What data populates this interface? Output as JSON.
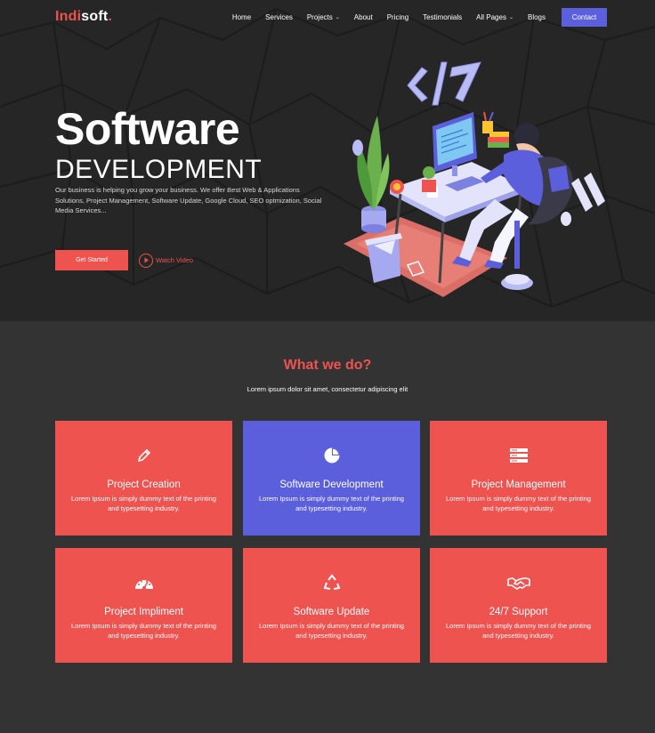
{
  "brand": {
    "part1": "Indi",
    "part2": "soft",
    "dot": "."
  },
  "nav": {
    "items": [
      {
        "label": "Home"
      },
      {
        "label": "Services"
      },
      {
        "label": "Projects",
        "chevron": "⌄"
      },
      {
        "label": "About"
      },
      {
        "label": "Pricing"
      },
      {
        "label": "Testimonials"
      },
      {
        "label": "All Pages",
        "chevron": "⌄"
      },
      {
        "label": "Blogs"
      }
    ],
    "contact_label": "Contact"
  },
  "hero": {
    "title": "Software",
    "subtitle": "DEVELOPMENT",
    "description": "Our business is helping you grow your business. We offer Best Web & Applications Solutions, Project Management, Software Update, Google Cloud, SEO optmization, Social Media Services...",
    "cta_label": "Get Started",
    "video_label": "Watch Video"
  },
  "services": {
    "title": "What we do?",
    "subtitle": "Lorem ipsum dolor sit amet, consectetur adipiscing elit",
    "cards": [
      {
        "title": "Project Creation",
        "text": "Lorem Ipsum is simply dummy text of the printing and typesetting industry.",
        "icon": "pencil-icon",
        "color": "#ef5350"
      },
      {
        "title": "Software Development",
        "text": "Lorem Ipsum is simply dummy text of the printing and typesetting industry.",
        "icon": "pie-chart-icon",
        "color": "#5c5fdc"
      },
      {
        "title": "Project Management",
        "text": "Lorem Ipsum is simply dummy text of the printing and typesetting industry.",
        "icon": "server-icon",
        "color": "#ef5350"
      },
      {
        "title": "Project Impliment",
        "text": "Lorem Ipsum is simply dummy text of the printing and typesetting industry.",
        "icon": "dashboard-icon",
        "color": "#ef5350"
      },
      {
        "title": "Software Update",
        "text": "Lorem Ipsum is simply dummy text of the printing and typesetting industry.",
        "icon": "recycle-icon",
        "color": "#ef5350"
      },
      {
        "title": "24/7 Support",
        "text": "Lorem Ipsum is simply dummy text of the printing and typesetting industry.",
        "icon": "handshake-icon",
        "color": "#ef5350"
      }
    ]
  },
  "colors": {
    "accent": "#ef5350",
    "secondary": "#5c5fdc",
    "hero_bg": "#262626",
    "page_bg": "#333333"
  }
}
